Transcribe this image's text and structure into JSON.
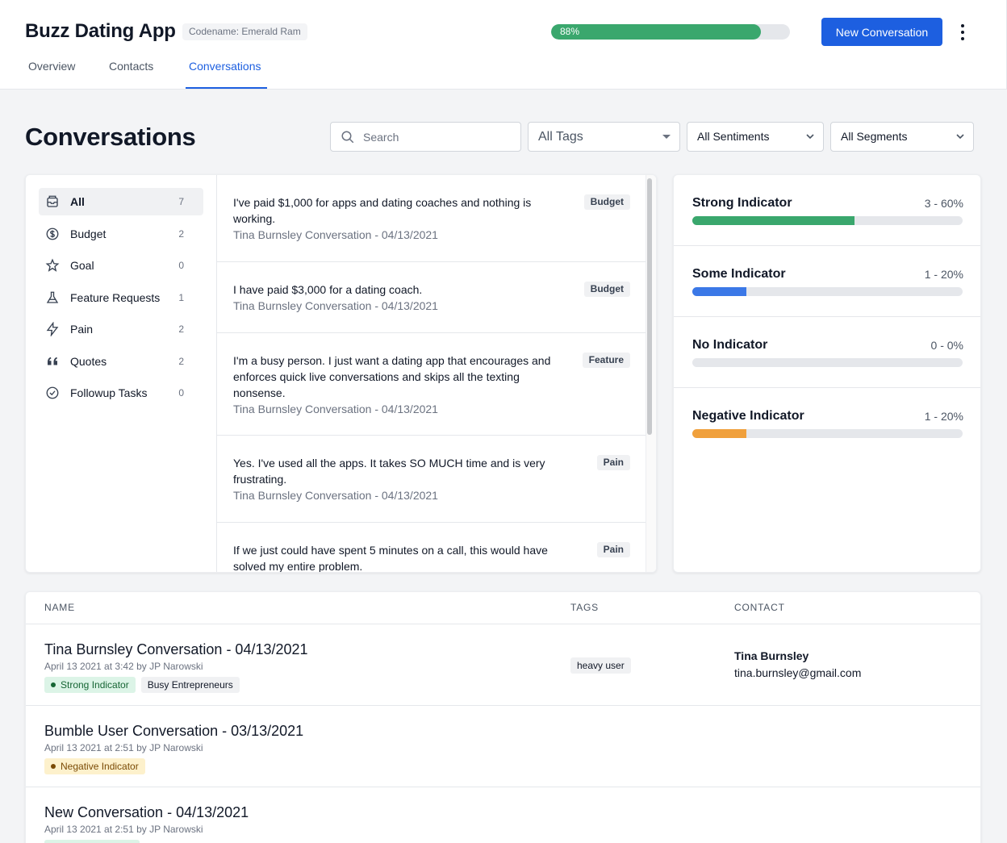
{
  "header": {
    "app_title": "Buzz Dating App",
    "codename": "Codename: Emerald Ram",
    "progress": {
      "label": "88%",
      "value": 0.88,
      "color": "#3aa76d"
    },
    "new_button": "New Conversation",
    "tabs": [
      {
        "label": "Overview",
        "active": false
      },
      {
        "label": "Contacts",
        "active": false
      },
      {
        "label": "Conversations",
        "active": true
      }
    ]
  },
  "page": {
    "title": "Conversations",
    "search_placeholder": "Search",
    "filters": {
      "tags": "All Tags",
      "sentiments": "All Sentiments",
      "segments": "All Segments"
    }
  },
  "tag_list": [
    {
      "label": "All",
      "count": "7",
      "icon": "inbox-icon",
      "active": true
    },
    {
      "label": "Budget",
      "count": "2",
      "icon": "dollar-circle-icon"
    },
    {
      "label": "Goal",
      "count": "0",
      "icon": "star-icon"
    },
    {
      "label": "Feature Requests",
      "count": "1",
      "icon": "beaker-icon"
    },
    {
      "label": "Pain",
      "count": "2",
      "icon": "bolt-icon"
    },
    {
      "label": "Quotes",
      "count": "2",
      "icon": "quote-icon"
    },
    {
      "label": "Followup Tasks",
      "count": "0",
      "icon": "check-circle-icon"
    }
  ],
  "messages": [
    {
      "text": "I've paid $1,000 for apps and dating coaches and nothing is working.",
      "sub": "Tina Burnsley Conversation - 04/13/2021",
      "badge": "Budget"
    },
    {
      "text": "I have paid $3,000 for a dating coach.",
      "sub": "Tina Burnsley Conversation - 04/13/2021",
      "badge": "Budget"
    },
    {
      "text": "I'm a busy person. I just want a dating app that encourages and enforces quick live conversations and skips all the texting nonsense.",
      "sub": "Tina Burnsley Conversation - 04/13/2021",
      "badge": "Feature"
    },
    {
      "text": "Yes. I've used all the apps. It takes SO MUCH time and is very frustrating.",
      "sub": "Tina Burnsley Conversation - 04/13/2021",
      "badge": "Pain"
    },
    {
      "text": "If we just could have spent 5 minutes on a call, this would have solved my entire problem.",
      "sub": "",
      "badge": "Pain"
    }
  ],
  "indicators": [
    {
      "name": "Strong Indicator",
      "value": "3 - 60%",
      "fraction": 0.6,
      "color": "#3aa76d"
    },
    {
      "name": "Some Indicator",
      "value": "1 - 20%",
      "fraction": 0.2,
      "color": "#3b78e7"
    },
    {
      "name": "No Indicator",
      "value": "0 - 0%",
      "fraction": 0,
      "color": "#9ca3af"
    },
    {
      "name": "Negative Indicator",
      "value": "1 - 20%",
      "fraction": 0.2,
      "color": "#f0a03c"
    }
  ],
  "table": {
    "headers": {
      "name": "NAME",
      "tags": "TAGS",
      "contact": "CONTACT"
    },
    "rows": [
      {
        "title": "Tina Burnsley Conversation - 04/13/2021",
        "meta": "April 13 2021 at 3:42 by JP Narowski",
        "sentiment": "Strong Indicator",
        "segment": "Busy Entrepreneurs",
        "tag": "heavy user",
        "contact_name": "Tina Burnsley",
        "contact_email": "tina.burnsley@gmail.com"
      },
      {
        "title": "Bumble User Conversation - 03/13/2021",
        "meta": "April 13 2021 at 2:51 by JP Narowski",
        "sentiment": "Negative Indicator"
      },
      {
        "title": "New Conversation - 04/13/2021",
        "meta": "April 13 2021 at 2:51 by JP Narowski"
      }
    ]
  }
}
